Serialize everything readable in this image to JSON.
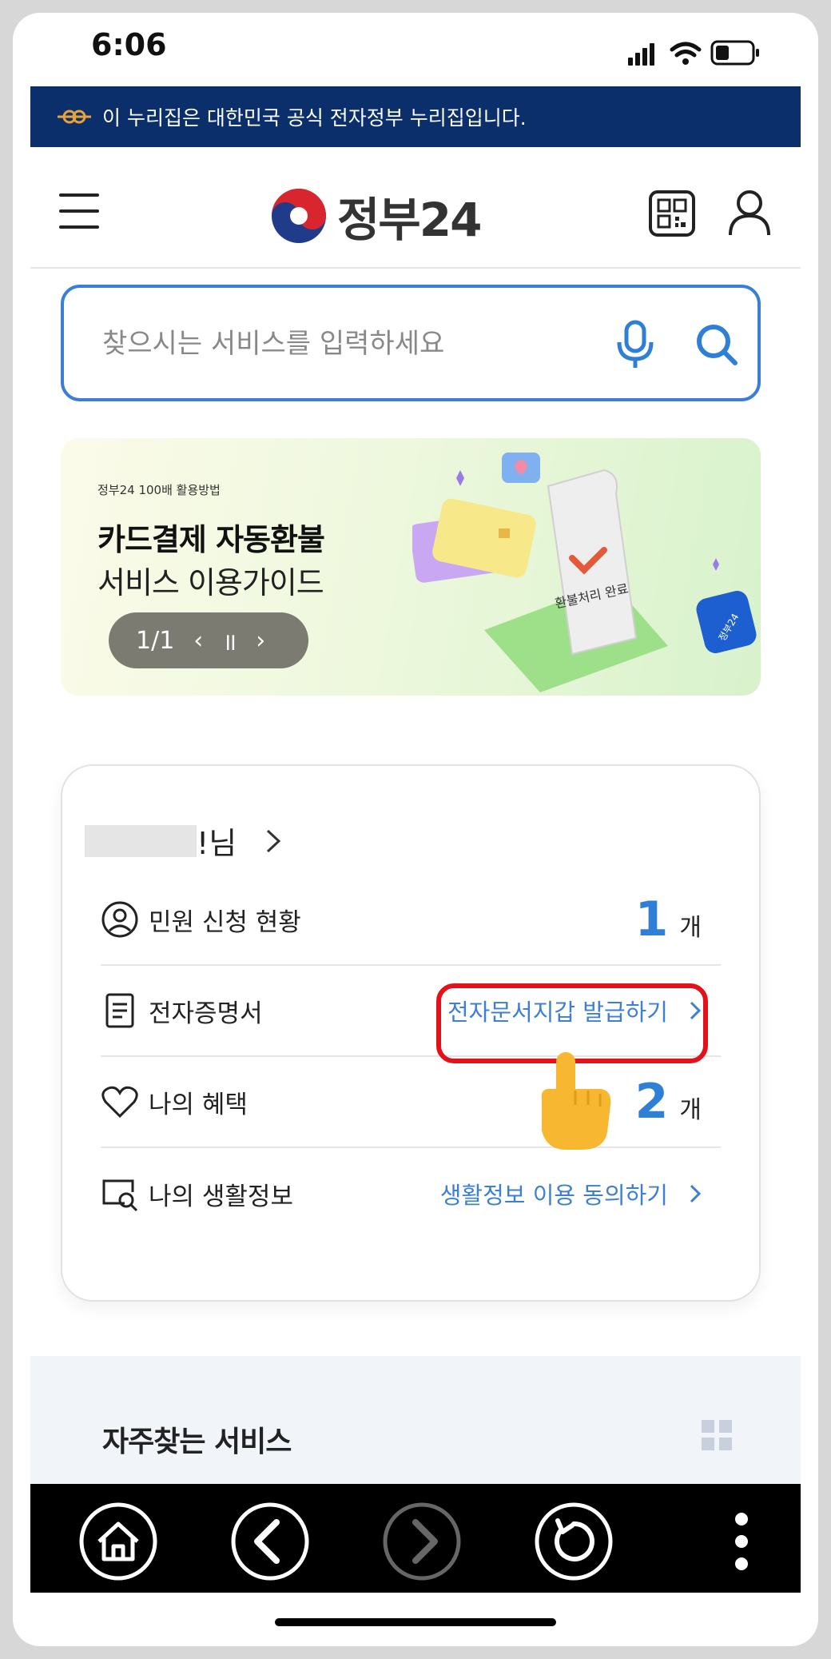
{
  "status_bar": {
    "time": "6:06"
  },
  "gov_banner": {
    "text": "이 누리집은 대한민국 공식 전자정부 누리집입니다."
  },
  "header": {
    "logo_text": "정부24"
  },
  "search": {
    "placeholder": "찾으시는 서비스를 입력하세요"
  },
  "promo": {
    "eyebrow": "정부24 100배 활용방법",
    "title": "카드결제 자동환불",
    "subtitle": "서비스 이용가이드",
    "pager": "1/1",
    "art_text": "환불처리 완료",
    "badge_text": "정부24"
  },
  "user_card": {
    "name_suffix": "!님",
    "rows": [
      {
        "label": "민원 신청 현황",
        "count": "1",
        "unit": "개"
      },
      {
        "label": "전자증명서",
        "link": "전자문서지갑 발급하기"
      },
      {
        "label": "나의 혜택",
        "count": "2",
        "unit": "개"
      },
      {
        "label": "나의 생활정보",
        "link": "생활정보 이용 동의하기"
      }
    ]
  },
  "frequent": {
    "title": "자주찾는 서비스"
  },
  "colors": {
    "accent": "#2f7fd6",
    "banner": "#0b2f6b",
    "highlight": "#e4101a"
  }
}
